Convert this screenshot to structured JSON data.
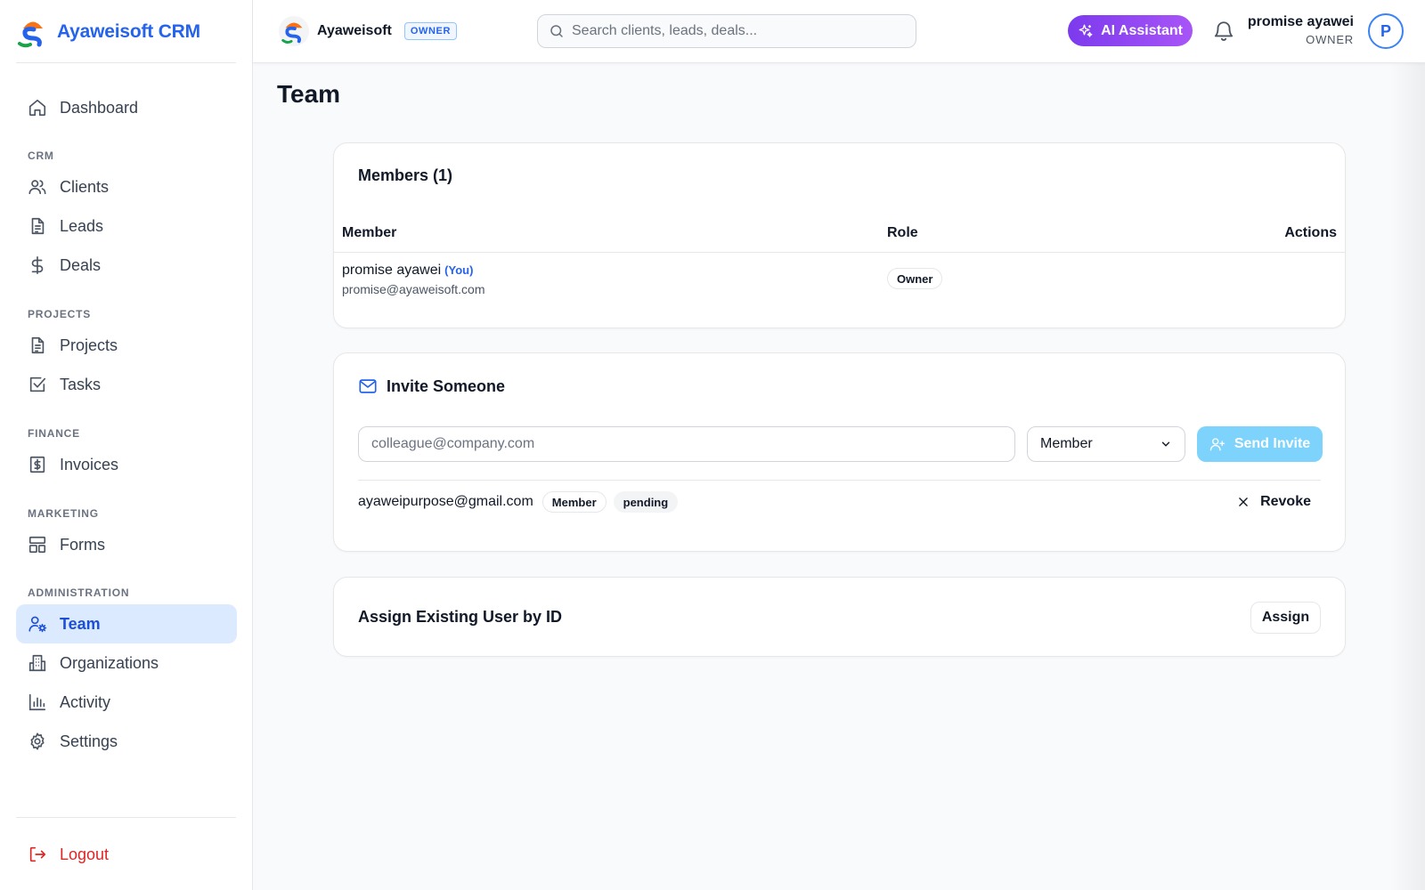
{
  "sidebar": {
    "brand": "Ayaweisoft CRM",
    "items": {
      "dashboard": "Dashboard",
      "clients": "Clients",
      "leads": "Leads",
      "deals": "Deals",
      "projects": "Projects",
      "tasks": "Tasks",
      "invoices": "Invoices",
      "forms": "Forms",
      "team": "Team",
      "organizations": "Organizations",
      "activity": "Activity",
      "settings": "Settings"
    },
    "sections": {
      "crm": "CRM",
      "projects": "PROJECTS",
      "finance": "FINANCE",
      "marketing": "MARKETING",
      "administration": "ADMINISTRATION"
    },
    "logout": "Logout",
    "active": "team"
  },
  "header": {
    "org_name": "Ayaweisoft",
    "org_role": "OWNER",
    "search_placeholder": "Search clients, leads, deals...",
    "ai_button": "AI Assistant",
    "user_name": "promise ayawei",
    "user_role": "OWNER",
    "avatar_initial": "P"
  },
  "page": {
    "title": "Team"
  },
  "members": {
    "title": "Members (1)",
    "columns": {
      "member": "Member",
      "role": "Role",
      "actions": "Actions"
    },
    "rows": [
      {
        "name": "promise ayawei",
        "you": "(You)",
        "email": "promise@ayaweisoft.com",
        "role": "Owner"
      }
    ]
  },
  "invite": {
    "title": "Invite Someone",
    "email_placeholder": "colleague@company.com",
    "role_value": "Member",
    "send_label": "Send Invite",
    "pending": [
      {
        "email": "ayaweipurpose@gmail.com",
        "role": "Member",
        "status": "pending",
        "action": "Revoke"
      }
    ]
  },
  "assign": {
    "title": "Assign Existing User by ID",
    "button": "Assign"
  },
  "colors": {
    "primary": "#2563eb",
    "active_bg": "#dbeafe",
    "ai_gradient_start": "#7c3aed",
    "ai_gradient_end": "#a855f7",
    "send_button": "#7dd3fc",
    "danger": "#dc2626"
  }
}
